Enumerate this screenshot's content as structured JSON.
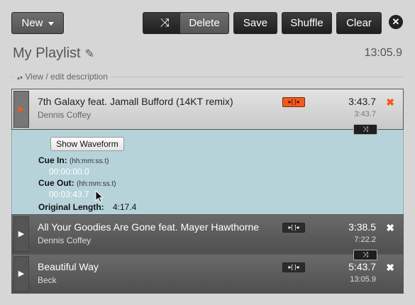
{
  "toolbar": {
    "new_label": "New",
    "delete_label": "Delete",
    "save_label": "Save",
    "shuffle_label": "Shuffle",
    "clear_label": "Clear",
    "shuffle_icon": "⤨",
    "close_icon": "✕"
  },
  "playlist": {
    "title": "My Playlist",
    "edit_icon": "✎",
    "total_length": "13:05.9",
    "description_toggle": "View / edit description"
  },
  "tracks": [
    {
      "title": "7th Galaxy feat. Jamall Bufford (14KT remix)",
      "artist": "Dennis Coffey",
      "duration": "3:43.7",
      "cumulative": "3:43.7",
      "expanded": true
    },
    {
      "title": "All Your Goodies Are Gone feat. Mayer Hawthorne",
      "artist": "Dennis Coffey",
      "duration": "3:38.5",
      "cumulative": "7:22.2",
      "expanded": false
    },
    {
      "title": "Beautiful Way",
      "artist": "Beck",
      "duration": "5:43.7",
      "cumulative": "13:05.9",
      "expanded": false
    }
  ],
  "details": {
    "waveform_button": "Show Waveform",
    "cue_in_label": "Cue In:",
    "cue_in_hint": "(hh:mm:ss.t)",
    "cue_in_value": "00:00:00.0",
    "cue_out_label": "Cue Out:",
    "cue_out_hint": "(hh:mm:ss.t)",
    "cue_out_value": "00:03:43.7",
    "original_length_label": "Original Length:",
    "original_length_value": "4:17.4"
  },
  "icons": {
    "play": "▶",
    "remove": "✖",
    "cue": "▸[ ]◂",
    "shuffle_between": "⤨"
  },
  "colors": {
    "accent_orange": "#f25a1e",
    "details_bg": "#b7d3da",
    "toolbar_dark": "#1f1f1f"
  }
}
